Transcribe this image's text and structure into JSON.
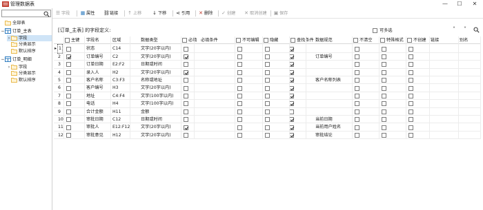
{
  "window": {
    "title": "管理数据表",
    "minimize": "—",
    "maximize": "☐",
    "close": "✕"
  },
  "tree": {
    "items": [
      {
        "label": "全部表",
        "level": 0,
        "type": "folder",
        "expand": ""
      },
      {
        "label": "订单_主表",
        "level": 0,
        "type": "table",
        "expand": "−"
      },
      {
        "label": "字段",
        "level": 1,
        "type": "folder",
        "selected": true,
        "expand": "›"
      },
      {
        "label": "分类显示",
        "level": 1,
        "type": "folder",
        "expand": ""
      },
      {
        "label": "默认排序",
        "level": 1,
        "type": "folder",
        "expand": ""
      },
      {
        "label": "订单_明细",
        "level": 0,
        "type": "table",
        "expand": "−"
      },
      {
        "label": "字段",
        "level": 1,
        "type": "folder",
        "expand": "›"
      },
      {
        "label": "分类显示",
        "level": 1,
        "type": "folder",
        "expand": ""
      },
      {
        "label": "默认排序",
        "level": 1,
        "type": "folder",
        "expand": ""
      }
    ]
  },
  "toolbar": {
    "field": "字段",
    "property": "属性",
    "link": "链接",
    "move_up": "上移",
    "move_down": "下移",
    "reference": "引用",
    "delete": "删除",
    "create": "创建",
    "cancel_create": "取消创建",
    "save": "保存"
  },
  "header": {
    "field_title": "[订单_主表] 的字段定义:",
    "multi_select": "可多选"
  },
  "columns": {
    "pk": "主键",
    "name": "字段名",
    "range": "区域",
    "dtype": "数据类型",
    "required": "必填",
    "required_cond": "必填条件",
    "not_editable": "不可编辑",
    "hidden": "隐藏",
    "lookup": "查找条件",
    "rule": "数据规范",
    "not_empty": "不清空",
    "special": "特殊格式",
    "not_create": "不创建",
    "chain": "链接",
    "alias": "别名"
  },
  "rows": [
    {
      "no": "1",
      "pk": false,
      "name": "状态",
      "range": "C14",
      "dtype": "文字(20字以内)",
      "required": false,
      "not_editable": false,
      "hidden": false,
      "lookup": true,
      "rule": "",
      "not_empty": false,
      "special": false,
      "not_create": false,
      "current": true
    },
    {
      "no": "2",
      "pk": true,
      "name": "订单编号",
      "range": "C2",
      "dtype": "文字(20字以内)",
      "required": true,
      "not_editable": false,
      "hidden": false,
      "lookup": true,
      "rule": "订单编号",
      "not_empty": false,
      "special": false,
      "not_create": false
    },
    {
      "no": "3",
      "pk": false,
      "name": "订单日期",
      "range": "E2:F2",
      "dtype": "日期或时间",
      "required": false,
      "not_editable": false,
      "hidden": false,
      "lookup": true,
      "rule": "",
      "not_empty": false,
      "special": false,
      "not_create": false
    },
    {
      "no": "4",
      "pk": false,
      "name": "录入人",
      "range": "H2",
      "dtype": "文字(20字以内)",
      "required": true,
      "not_editable": false,
      "hidden": false,
      "lookup": true,
      "rule": "",
      "not_empty": false,
      "special": false,
      "not_create": false
    },
    {
      "no": "5",
      "pk": false,
      "name": "客户名称",
      "range": "C3:F3",
      "dtype": "名称或地址",
      "required": false,
      "not_editable": false,
      "hidden": false,
      "lookup": true,
      "rule": "客户名称列表",
      "not_empty": false,
      "special": false,
      "not_create": false
    },
    {
      "no": "6",
      "pk": false,
      "name": "客户编号",
      "range": "H3",
      "dtype": "文字(20字以内)",
      "required": false,
      "not_editable": false,
      "hidden": false,
      "lookup": true,
      "rule": "",
      "not_empty": false,
      "special": false,
      "not_create": false
    },
    {
      "no": "7",
      "pk": false,
      "name": "地址",
      "range": "C4:F4",
      "dtype": "文字(100字以内)",
      "required": false,
      "not_editable": false,
      "hidden": false,
      "lookup": true,
      "rule": "",
      "not_empty": false,
      "special": false,
      "not_create": false
    },
    {
      "no": "8",
      "pk": false,
      "name": "电话",
      "range": "H4",
      "dtype": "文字(100字以内)",
      "required": false,
      "not_editable": false,
      "hidden": false,
      "lookup": true,
      "rule": "",
      "not_empty": false,
      "special": false,
      "not_create": false
    },
    {
      "no": "9",
      "pk": false,
      "name": "合计金额",
      "range": "H11",
      "dtype": "金额",
      "required": false,
      "not_editable": false,
      "hidden": false,
      "lookup": false,
      "rule": "",
      "not_empty": false,
      "special": false,
      "not_create": false
    },
    {
      "no": "10",
      "pk": false,
      "name": "审批日期",
      "range": "C12",
      "dtype": "日期或时间",
      "required": false,
      "not_editable": false,
      "hidden": false,
      "lookup": true,
      "rule": "当前日期",
      "not_empty": false,
      "special": false,
      "not_create": false
    },
    {
      "no": "11",
      "pk": false,
      "name": "审批人",
      "range": "E12:F12",
      "dtype": "文字(20字以内)",
      "required": true,
      "not_editable": false,
      "hidden": false,
      "lookup": true,
      "rule": "当前用户姓名",
      "not_empty": false,
      "special": false,
      "not_create": false
    },
    {
      "no": "12",
      "pk": false,
      "name": "审批意见",
      "range": "H12",
      "dtype": "文字(20字以内)",
      "required": false,
      "not_editable": false,
      "hidden": false,
      "lookup": true,
      "rule": "审批结论",
      "not_empty": false,
      "special": false,
      "not_create": false
    }
  ],
  "colors": {
    "selection": "#cfe4f7",
    "folder": "#e8b84a",
    "table_icon": "#2d7bbf",
    "disabled": "#9a9a9a"
  },
  "icons": [
    "app-icon",
    "search-icon",
    "folder-icon",
    "table-icon",
    "field-icon",
    "property-icon",
    "link-icon",
    "arrow-up-icon",
    "arrow-down-icon",
    "reference-icon",
    "delete-icon",
    "create-icon",
    "cancel-create-icon",
    "save-icon",
    "chevron-up-icon",
    "chevron-down-icon"
  ]
}
